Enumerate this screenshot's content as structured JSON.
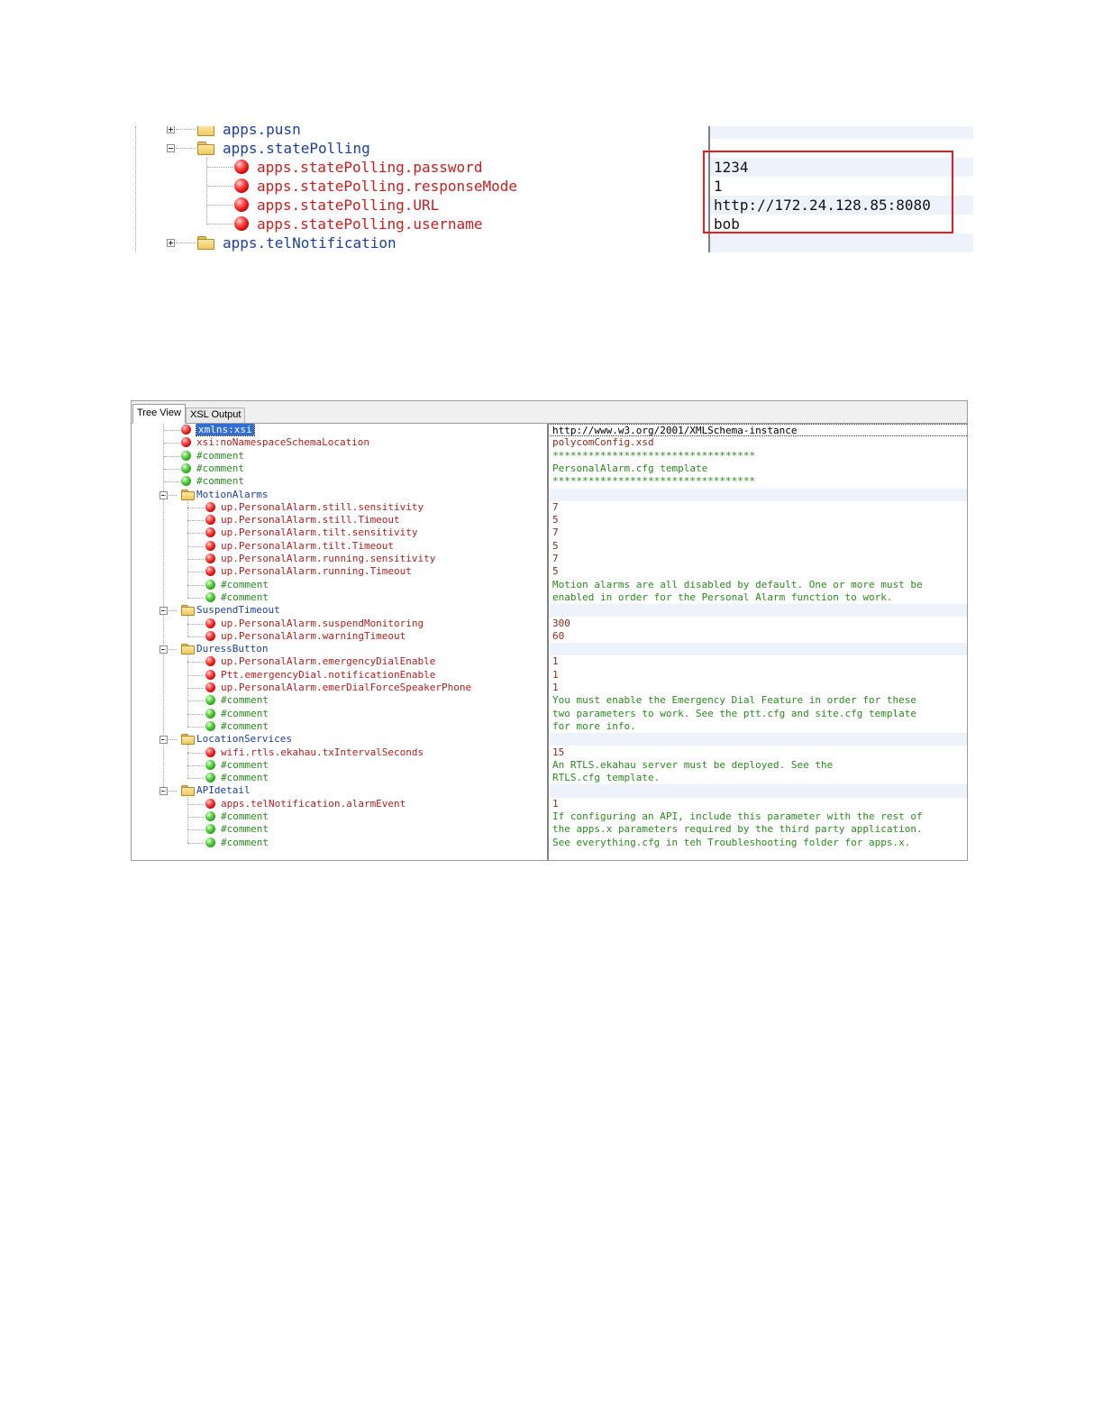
{
  "top_snippet": {
    "tree_rows": [
      {
        "label": "apps.push",
        "type": "folder",
        "expander": "plus",
        "depth": 0
      },
      {
        "label": "apps.statePolling",
        "type": "folder",
        "expander": "minus",
        "depth": 0
      },
      {
        "label": "apps.statePolling.password",
        "type": "attribute",
        "depth": 1
      },
      {
        "label": "apps.statePolling.responseMode",
        "type": "attribute",
        "depth": 1
      },
      {
        "label": "apps.statePolling.URL",
        "type": "attribute",
        "depth": 1
      },
      {
        "label": "apps.statePolling.username",
        "type": "attribute",
        "depth": 1
      },
      {
        "label": "apps.telNotification",
        "type": "folder",
        "expander": "plus",
        "depth": 0
      }
    ],
    "values": [
      "",
      "",
      "1234",
      "1",
      "http://172.24.128.85:8080",
      "bob",
      ""
    ],
    "highlight_color": "#e01e25"
  },
  "xml_window": {
    "tabs": [
      {
        "label": "Tree View",
        "active": true
      },
      {
        "label": "XSL Output",
        "active": false
      }
    ],
    "rows": [
      {
        "label": "xmlns:xsi",
        "type": "attribute",
        "depth": 0,
        "selected": true,
        "value": "http://www.w3.org/2001/XMLSchema-instance"
      },
      {
        "label": "xsi:noNamespaceSchemaLocation",
        "type": "attribute",
        "depth": 0,
        "value": "polycomConfig.xsd"
      },
      {
        "label": "#comment",
        "type": "comment",
        "depth": 0,
        "value": "**********************************"
      },
      {
        "label": "#comment",
        "type": "comment",
        "depth": 0,
        "value": "PersonalAlarm.cfg template"
      },
      {
        "label": "#comment",
        "type": "comment",
        "depth": 0,
        "value": "**********************************"
      },
      {
        "label": "MotionAlarms",
        "type": "folder",
        "depth": 0,
        "value": ""
      },
      {
        "label": "up.PersonalAlarm.still.sensitivity",
        "type": "attribute",
        "depth": 1,
        "value": "7"
      },
      {
        "label": "up.PersonalAlarm.still.Timeout",
        "type": "attribute",
        "depth": 1,
        "value": "5"
      },
      {
        "label": "up.PersonalAlarm.tilt.sensitivity",
        "type": "attribute",
        "depth": 1,
        "value": "7"
      },
      {
        "label": "up.PersonalAlarm.tilt.Timeout",
        "type": "attribute",
        "depth": 1,
        "value": "5"
      },
      {
        "label": "up.PersonalAlarm.running.sensitivity",
        "type": "attribute",
        "depth": 1,
        "value": "7"
      },
      {
        "label": "up.PersonalAlarm.running.Timeout",
        "type": "attribute",
        "depth": 1,
        "value": "5"
      },
      {
        "label": "#comment",
        "type": "comment",
        "depth": 1,
        "value": "Motion alarms are all disabled by default. One or more must be"
      },
      {
        "label": "#comment",
        "type": "comment",
        "depth": 1,
        "value": "enabled in order for the Personal Alarm function to work."
      },
      {
        "label": "SuspendTimeout",
        "type": "folder",
        "depth": 0,
        "value": ""
      },
      {
        "label": "up.PersonalAlarm.suspendMonitoring",
        "type": "attribute",
        "depth": 1,
        "value": "300"
      },
      {
        "label": "up.PersonalAlarm.warningTimeout",
        "type": "attribute",
        "depth": 1,
        "value": "60"
      },
      {
        "label": "DuressButton",
        "type": "folder",
        "depth": 0,
        "value": ""
      },
      {
        "label": "up.PersonalAlarm.emergencyDialEnable",
        "type": "attribute",
        "depth": 1,
        "value": "1"
      },
      {
        "label": "Ptt.emergencyDial.notificationEnable",
        "type": "attribute",
        "depth": 1,
        "value": "1"
      },
      {
        "label": "up.PersonalAlarm.emerDialForceSpeakerPhone",
        "type": "attribute",
        "depth": 1,
        "value": "1"
      },
      {
        "label": "#comment",
        "type": "comment",
        "depth": 1,
        "value": "You must enable the Emergency Dial Feature in order for these"
      },
      {
        "label": "#comment",
        "type": "comment",
        "depth": 1,
        "value": "two parameters to work. See the ptt.cfg and site.cfg template"
      },
      {
        "label": "#comment",
        "type": "comment",
        "depth": 1,
        "value": "for more info."
      },
      {
        "label": "LocationServices",
        "type": "folder",
        "depth": 0,
        "value": ""
      },
      {
        "label": "wifi.rtls.ekahau.txIntervalSeconds",
        "type": "attribute",
        "depth": 1,
        "value": "15"
      },
      {
        "label": "#comment",
        "type": "comment",
        "depth": 1,
        "value": "An RTLS.ekahau server must be deployed. See the"
      },
      {
        "label": "#comment",
        "type": "comment",
        "depth": 1,
        "value": "RTLS.cfg template."
      },
      {
        "label": "APIdetail",
        "type": "folder",
        "depth": 0,
        "value": ""
      },
      {
        "label": "apps.telNotification.alarmEvent",
        "type": "attribute",
        "depth": 1,
        "value": "1"
      },
      {
        "label": "#comment",
        "type": "comment",
        "depth": 1,
        "value": "If configuring an API, include this parameter with the rest of"
      },
      {
        "label": "#comment",
        "type": "comment",
        "depth": 1,
        "value": "the apps.x parameters required by the third party application."
      },
      {
        "label": "#comment",
        "type": "comment",
        "depth": 1,
        "value": "See everything.cfg in teh Troubleshooting folder for apps.x."
      }
    ]
  },
  "icons": {
    "attribute": "red-ball-icon",
    "comment": "green-ball-icon",
    "folder": "folder-icon",
    "expand": "plus-box-icon",
    "collapse": "minus-box-icon"
  },
  "colors": {
    "attribute_text": "#b21f1f",
    "folder_text": "#1a3fa0",
    "comment_text": "#2a8a1f",
    "selection": "#2f6fd6"
  }
}
